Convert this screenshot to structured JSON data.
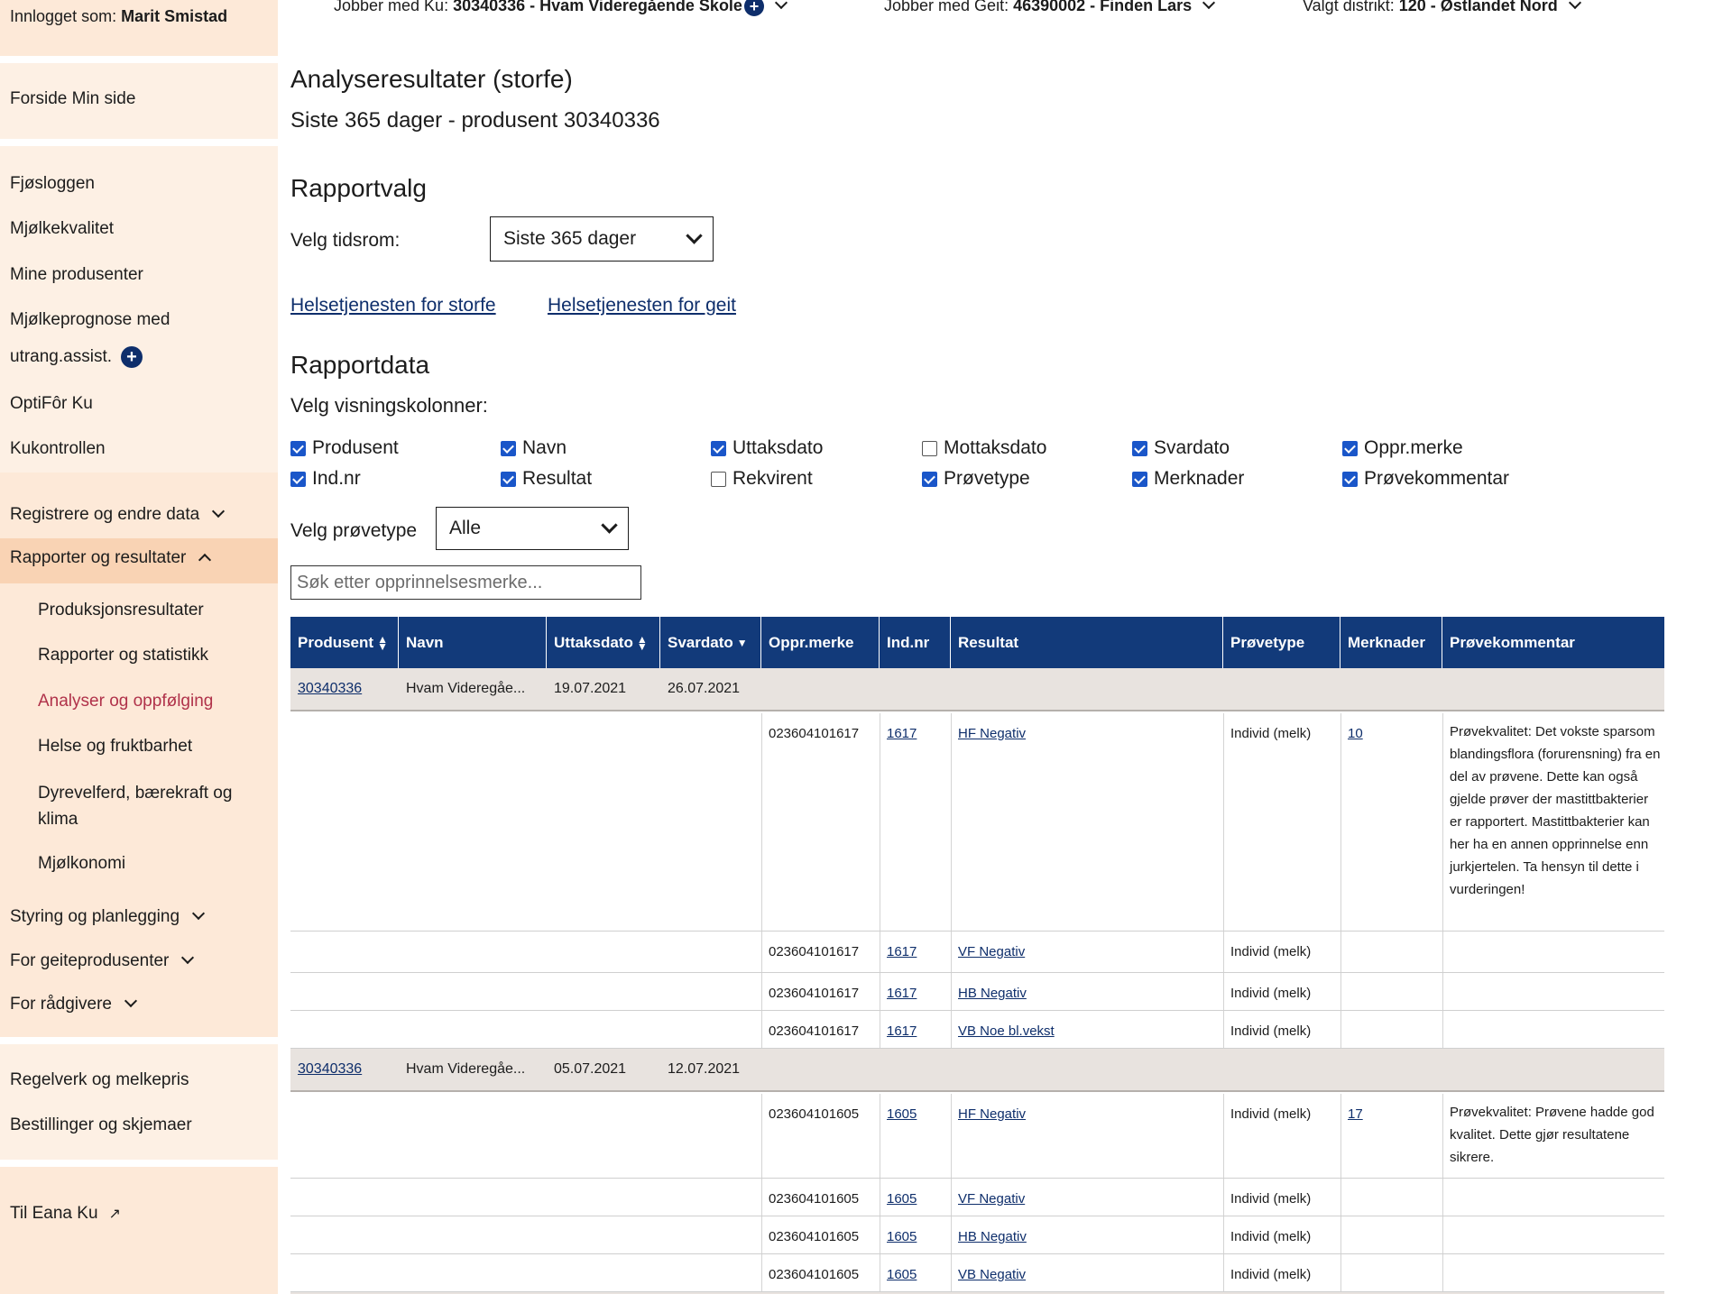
{
  "topbar": {
    "ku_label": "Jobber med Ku:",
    "ku_value": "30340336 - Hvam Videregående Skole",
    "geit_label": "Jobber med Geit:",
    "geit_value": "46390002 - Finden Lars",
    "distrikt_label": "Valgt distrikt:",
    "distrikt_value": "120 - Østlandet Nord"
  },
  "sidebar": {
    "logged_in_label": "Innlogget som:",
    "logged_in_user": "Marit Smistad",
    "home": "Forside Min side",
    "items": [
      "Fjøsloggen",
      "Mjølkekvalitet",
      "Mine produsenter",
      "Mjølkeprognose med",
      "utrang.assist.",
      "OptiFôr Ku",
      "Kukontrollen"
    ],
    "sections": {
      "registrere": "Registrere og endre data",
      "rapporter": "Rapporter og resultater",
      "styring": "Styring og planlegging",
      "geit": "For geiteprodusenter",
      "radgivere": "For rådgivere"
    },
    "sub_items": [
      "Produksjonsresultater",
      "Rapporter og statistikk",
      "Analyser og oppfølging",
      "Helse og fruktbarhet",
      "Dyrevelferd, bærekraft og",
      "klima",
      "Mjølkonomi"
    ],
    "bottom": [
      "Regelverk og melkepris",
      "Bestillinger og skjemaer"
    ],
    "external": "Til Eana Ku",
    "accent_color": "#b0324a"
  },
  "main": {
    "title": "Analyseresultater (storfe)",
    "subtitle": "Siste 365 dager - produsent 30340336",
    "rapportvalg_heading": "Rapportvalg",
    "period_label": "Velg tidsrom:",
    "period_value": "Siste 365 dager",
    "link_storfe": "Helsetjenesten for storfe",
    "link_geit": "Helsetjenesten for geit",
    "rapportdata_heading": "Rapportdata",
    "columns_label": "Velg visningskolonner:",
    "columns": [
      {
        "label": "Produsent",
        "checked": true
      },
      {
        "label": "Navn",
        "checked": true
      },
      {
        "label": "Uttaksdato",
        "checked": true
      },
      {
        "label": "Mottaksdato",
        "checked": false
      },
      {
        "label": "Svardato",
        "checked": true
      },
      {
        "label": "Oppr.merke",
        "checked": true
      },
      {
        "label": "Ind.nr",
        "checked": true
      },
      {
        "label": "Resultat",
        "checked": true
      },
      {
        "label": "Rekvirent",
        "checked": false
      },
      {
        "label": "Prøvetype",
        "checked": true
      },
      {
        "label": "Merknader",
        "checked": true
      },
      {
        "label": "Prøvekommentar",
        "checked": true
      }
    ],
    "provetype_label": "Velg prøvetype",
    "provetype_value": "Alle",
    "search_placeholder": "Søk etter opprinnelsesmerke..."
  },
  "table": {
    "headers": [
      "Produsent",
      "Navn",
      "Uttaksdato",
      "Svardato",
      "Oppr.merke",
      "Ind.nr",
      "Resultat",
      "Prøvetype",
      "Merknader",
      "Prøvekommentar"
    ],
    "groups": [
      {
        "produsent": "30340336",
        "navn": "Hvam Videregåe...",
        "uttaksdato": "19.07.2021",
        "svardato": "26.07.2021",
        "rows": [
          {
            "oppr": "023604101617",
            "ind": "1617",
            "resultat": "HF Negativ",
            "provetype": "Individ (melk)",
            "merknad": "10",
            "kommentar": "Prøvekvalitet: Det vokste sparsom blandingsflora (forurensning) fra en del av prøvene. Dette kan også gjelde prøver der mastittbakterier er rapportert. Mastittbakterier kan her ha en annen opprinnelse enn jurkjertelen. Ta hensyn til dette i vurderingen!"
          },
          {
            "oppr": "023604101617",
            "ind": "1617",
            "resultat": "VF Negativ",
            "provetype": "Individ (melk)",
            "merknad": "",
            "kommentar": ""
          },
          {
            "oppr": "023604101617",
            "ind": "1617",
            "resultat": "HB Negativ",
            "provetype": "Individ (melk)",
            "merknad": "",
            "kommentar": ""
          },
          {
            "oppr": "023604101617",
            "ind": "1617",
            "resultat": "VB Noe bl.vekst",
            "provetype": "Individ (melk)",
            "merknad": "",
            "kommentar": ""
          }
        ]
      },
      {
        "produsent": "30340336",
        "navn": "Hvam Videregåe...",
        "uttaksdato": "05.07.2021",
        "svardato": "12.07.2021",
        "rows": [
          {
            "oppr": "023604101605",
            "ind": "1605",
            "resultat": "HF Negativ",
            "provetype": "Individ (melk)",
            "merknad": "17",
            "kommentar": "Prøvekvalitet: Prøvene hadde god kvalitet. Dette gjør resultatene sikrere."
          },
          {
            "oppr": "023604101605",
            "ind": "1605",
            "resultat": "VF Negativ",
            "provetype": "Individ (melk)",
            "merknad": "",
            "kommentar": ""
          },
          {
            "oppr": "023604101605",
            "ind": "1605",
            "resultat": "HB Negativ",
            "provetype": "Individ (melk)",
            "merknad": "",
            "kommentar": ""
          },
          {
            "oppr": "023604101605",
            "ind": "1605",
            "resultat": "VB Negativ",
            "provetype": "Individ (melk)",
            "merknad": "",
            "kommentar": ""
          }
        ]
      }
    ],
    "header_color": "#123a7a",
    "group_color": "#e8e3df"
  }
}
